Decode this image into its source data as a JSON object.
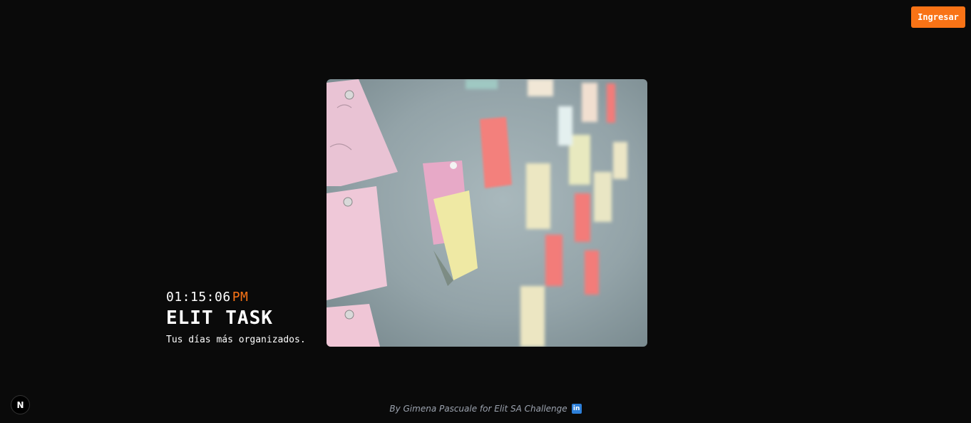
{
  "header": {
    "login_label": "Ingresar"
  },
  "hero": {
    "time": "01:15:06",
    "ampm": "PM",
    "title": "ELIT TASK",
    "tagline": "Tus días más organizados."
  },
  "footer": {
    "credit": "By Gimena Pascuale for Elit SA Challenge",
    "linkedin_icon": "linkedin-icon"
  },
  "badge": {
    "label": "N"
  },
  "colors": {
    "accent": "#f97316",
    "background": "#0a0a0a",
    "linkedin": "#2d7fd8"
  }
}
